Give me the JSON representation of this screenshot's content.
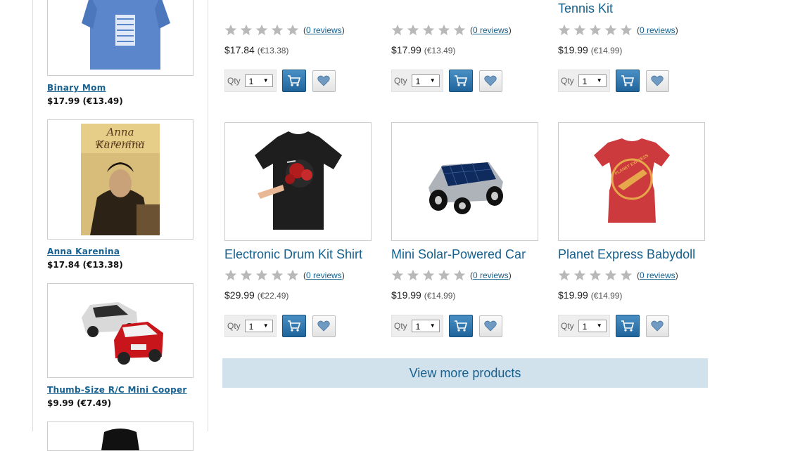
{
  "sidebar": {
    "items": [
      {
        "name": "Binary Mom",
        "price": "$17.99 (€13.49)"
      },
      {
        "name": "Anna Karenina",
        "price": "$17.84 (€13.38)",
        "book_title": "Anna Karenina",
        "book_author": "Leo Tolstoy"
      },
      {
        "name": "Thumb-Size R/C Mini Cooper",
        "price": "$9.99 (€7.49)"
      }
    ]
  },
  "products": [
    {
      "name": "",
      "reviews": "0 reviews",
      "price": "$17.84",
      "price_eur": "(€13.38)",
      "qty": "1"
    },
    {
      "name": "",
      "reviews": "0 reviews",
      "price": "$17.99",
      "price_eur": "(€13.49)",
      "qty": "1"
    },
    {
      "name": "Tennis Kit",
      "reviews": "0 reviews",
      "price": "$19.99",
      "price_eur": "(€14.99)",
      "qty": "1"
    },
    {
      "name": "Electronic Drum Kit Shirt",
      "reviews": "0 reviews",
      "price": "$29.99",
      "price_eur": "(€22.49)",
      "qty": "1"
    },
    {
      "name": "Mini Solar-Powered Car",
      "reviews": "0 reviews",
      "price": "$19.99",
      "price_eur": "(€14.99)",
      "qty": "1"
    },
    {
      "name": "Planet Express Babydoll",
      "reviews": "0 reviews",
      "price": "$19.99",
      "price_eur": "(€14.99)",
      "qty": "1"
    }
  ],
  "labels": {
    "qty": "Qty",
    "view_more": "View more products",
    "shirt_print": "01010101 01010101 01010101",
    "planet_express_logo": "PLANET EXPRESS"
  },
  "colors": {
    "link": "#16608e",
    "view_more_bg": "#d2e2ed",
    "cart_button": "#2a72aa",
    "star": "#b9b9b9"
  },
  "icons": {
    "star": "star-icon",
    "cart": "cart-icon",
    "wishlist": "heart-icon",
    "dropdown": "chevron-down-icon"
  }
}
